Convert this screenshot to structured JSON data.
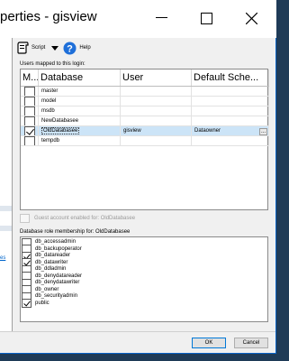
{
  "window": {
    "title": "perties - gisview",
    "left_link": "es"
  },
  "toolbar": {
    "script_label": "Script",
    "help_label": "Help",
    "icons": [
      "script-icon",
      "dropdown-arrow-icon",
      "help-icon"
    ]
  },
  "users": {
    "label": "Users mapped to this login:",
    "headers": [
      "M...",
      "Database",
      "User",
      "Default Sche..."
    ],
    "rows": [
      {
        "map": "",
        "database": "master",
        "user": "",
        "schema": ""
      },
      {
        "map": "",
        "database": "model",
        "user": "",
        "schema": ""
      },
      {
        "map": "",
        "database": "msdb",
        "user": "",
        "schema": ""
      },
      {
        "map": "",
        "database": "NewDatabasee",
        "user": "",
        "schema": ""
      },
      {
        "map": "checked",
        "database": "OldDatabasee",
        "user": "gisview",
        "schema": "Dataowner",
        "button": "..."
      },
      {
        "map": "",
        "database": "tempdb",
        "user": "",
        "schema": ""
      }
    ]
  },
  "guest": {
    "label": "Guest account enabled for: OldDatabasee"
  },
  "roles": {
    "label": "Database role membership for: OldDatabasee",
    "items": [
      {
        "name": "db_accessadmin",
        "checked": false
      },
      {
        "name": "db_backupoperator",
        "checked": false
      },
      {
        "name": "db_datareader",
        "checked": true
      },
      {
        "name": "db_datawriter",
        "checked": true
      },
      {
        "name": "db_ddladmin",
        "checked": false
      },
      {
        "name": "db_denydatareader",
        "checked": false
      },
      {
        "name": "db_denydatawriter",
        "checked": false
      },
      {
        "name": "db_owner",
        "checked": false
      },
      {
        "name": "db_securityadmin",
        "checked": false
      },
      {
        "name": "public",
        "checked": true
      }
    ]
  },
  "buttons": {
    "ok": "OK",
    "cancel": "Cancel"
  },
  "colors": {
    "selection": "#cce4f7",
    "accent": "#0078d7"
  }
}
